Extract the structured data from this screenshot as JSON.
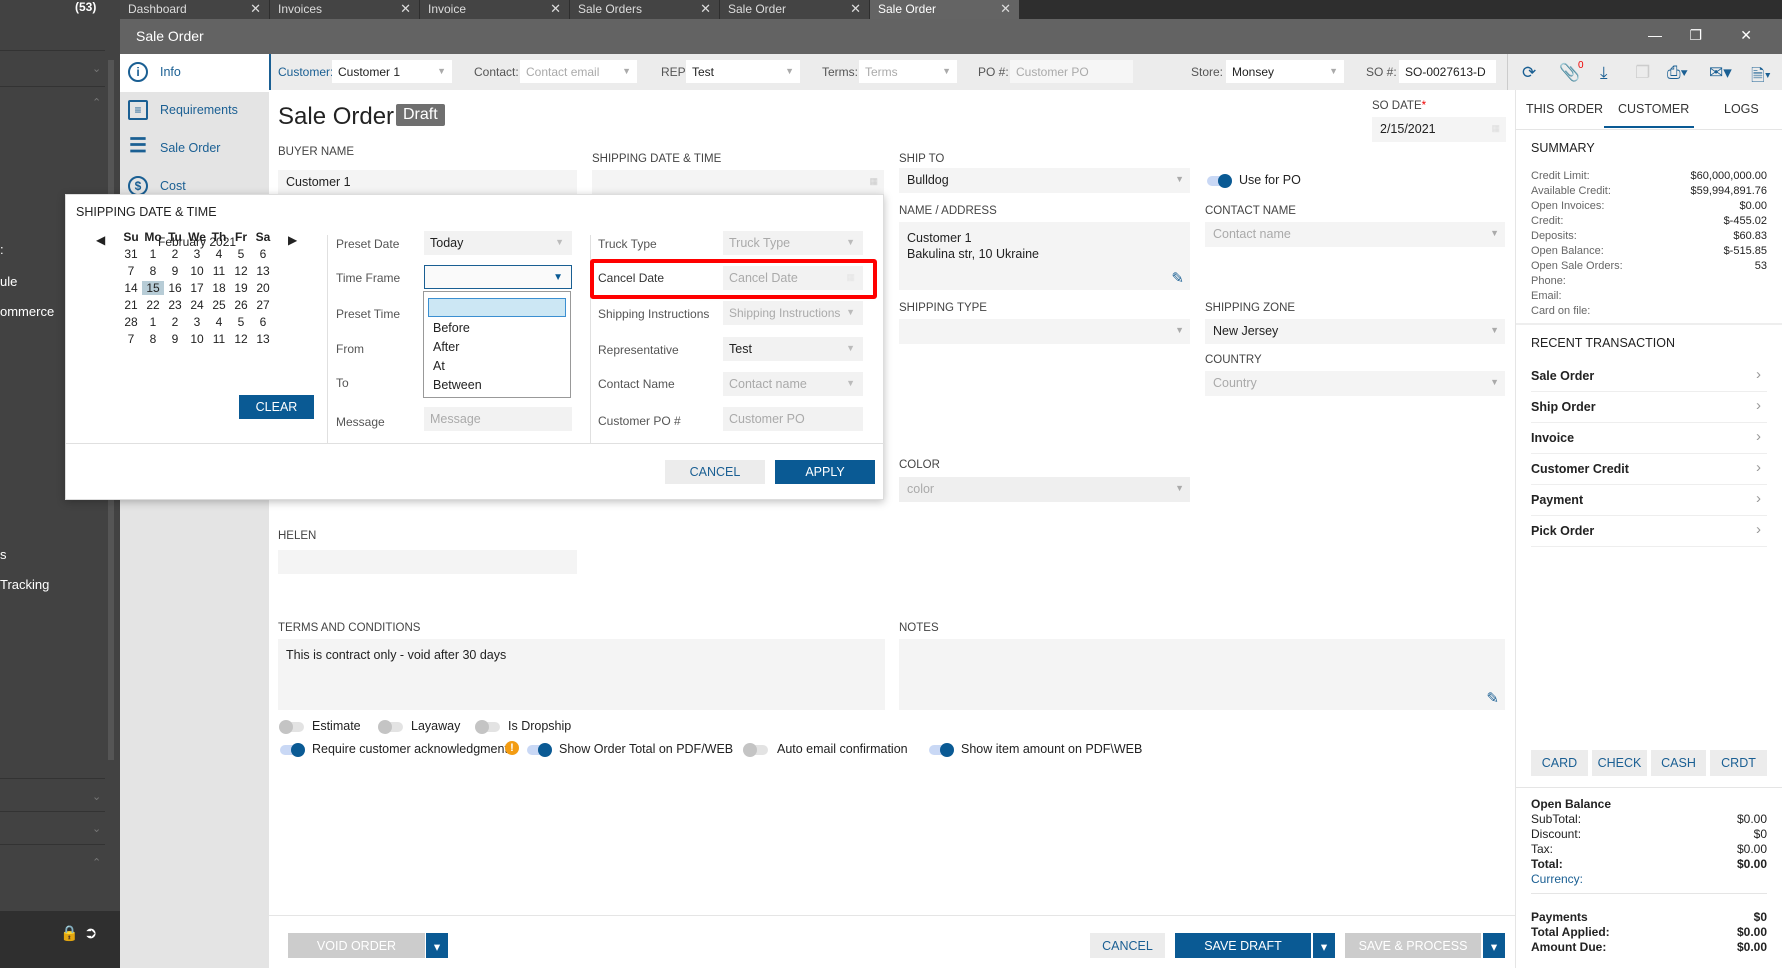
{
  "sidebar_dark": {
    "count": "(53)",
    "items": [
      ":",
      "ule",
      "ommerce",
      "s",
      "Tracking"
    ]
  },
  "tabs": [
    {
      "label": "Dashboard"
    },
    {
      "label": "Invoices"
    },
    {
      "label": "Invoice"
    },
    {
      "label": "Sale Orders"
    },
    {
      "label": "Sale Order"
    },
    {
      "label": "Sale Order",
      "active": true
    }
  ],
  "window": {
    "title": "Sale Order"
  },
  "nav": [
    {
      "label": "Info",
      "icon": "info-icon"
    },
    {
      "label": "Requirements",
      "icon": "clipboard-icon"
    },
    {
      "label": "Sale Order",
      "icon": "list-icon"
    },
    {
      "label": "Cost",
      "icon": "dollar-icon"
    }
  ],
  "toolbar": {
    "customer_label": "Customer:",
    "customer": "Customer 1",
    "contact_label": "Contact:",
    "contact_placeholder": "Contact email",
    "rep_label": "REP:",
    "rep": "Test",
    "terms_label": "Terms:",
    "terms_placeholder": "Terms",
    "po_label": "PO #:",
    "po_placeholder": "Customer PO",
    "store_label": "Store:",
    "store": "Monsey",
    "so_label": "SO #:",
    "so_number": "SO-0027613-D",
    "attachment_count": "0"
  },
  "form": {
    "title": "Sale Order",
    "status": "Draft",
    "so_date_label": "SO DATE",
    "so_date_required": "*",
    "so_date": "2/15/2021",
    "buyer_name_label": "BUYER NAME",
    "buyer_name": "Customer 1",
    "shipping_date_label": "SHIPPING DATE & TIME",
    "ship_to_label": "SHIP TO",
    "ship_to": "Bulldog",
    "use_for_po": "Use for PO",
    "name_address_label": "NAME / ADDRESS",
    "name_line": "Customer 1",
    "address_line": "Bakulina str, 10 Ukraine",
    "contact_name_label": "CONTACT NAME",
    "contact_name_placeholder": "Contact name",
    "shipping_type_label": "SHIPPING TYPE",
    "shipping_zone_label": "SHIPPING ZONE",
    "shipping_zone": "New Jersey",
    "country_label": "COUNTRY",
    "country_placeholder": "Country",
    "color_label": "COLOR",
    "color_placeholder": "color",
    "helen_label": "HELEN",
    "terms_label": "TERMS AND CONDITIONS",
    "terms_text": "This is contract only - void after 30 days",
    "notes_label": "NOTES",
    "toggles": [
      {
        "label": "Estimate",
        "on": false
      },
      {
        "label": "Layaway",
        "on": false
      },
      {
        "label": "Is Dropship",
        "on": false
      },
      {
        "label": "Require customer acknowledgment",
        "on": true
      },
      {
        "label": "Show Order Total on PDF/WEB",
        "on": true
      },
      {
        "label": "Auto email confirmation",
        "on": false
      },
      {
        "label": "Show item amount on PDF\\WEB",
        "on": true
      }
    ]
  },
  "bottom": {
    "void": "VOID ORDER",
    "cancel": "CANCEL",
    "save_draft": "SAVE DRAFT",
    "save_process": "SAVE & PROCESS"
  },
  "popup": {
    "title": "SHIPPING DATE & TIME",
    "month": "February 2021",
    "weekdays": [
      "Su",
      "Mo",
      "Tu",
      "We",
      "Th",
      "Fr",
      "Sa"
    ],
    "days": [
      [
        "31",
        "1",
        "2",
        "3",
        "4",
        "5",
        "6"
      ],
      [
        "7",
        "8",
        "9",
        "10",
        "11",
        "12",
        "13"
      ],
      [
        "14",
        "15",
        "16",
        "17",
        "18",
        "19",
        "20"
      ],
      [
        "21",
        "22",
        "23",
        "24",
        "25",
        "26",
        "27"
      ],
      [
        "28",
        "1",
        "2",
        "3",
        "4",
        "5",
        "6"
      ],
      [
        "7",
        "8",
        "9",
        "10",
        "11",
        "12",
        "13"
      ]
    ],
    "selected_day": "15",
    "clear": "CLEAR",
    "preset_date_label": "Preset Date",
    "preset_date": "Today",
    "time_frame_label": "Time Frame",
    "time_frame_options": [
      "",
      "Before",
      "After",
      "At",
      "Between"
    ],
    "preset_time_label": "Preset Time",
    "from_label": "From",
    "to_label": "To",
    "message_label": "Message",
    "message_placeholder": "Message",
    "truck_type_label": "Truck Type",
    "truck_type_placeholder": "Truck Type",
    "cancel_date_label": "Cancel Date",
    "cancel_date_placeholder": "Cancel Date",
    "shipping_instructions_label": "Shipping Instructions",
    "shipping_instructions_placeholder": "Shipping Instructions",
    "representative_label": "Representative",
    "representative": "Test",
    "contact_name_label": "Contact Name",
    "contact_name_placeholder": "Contact name",
    "customer_po_label": "Customer PO #",
    "customer_po_placeholder": "Customer PO",
    "cancel": "CANCEL",
    "apply": "APPLY"
  },
  "right": {
    "tabs": [
      "THIS ORDER",
      "CUSTOMER",
      "LOGS"
    ],
    "summary_title": "SUMMARY",
    "summary": [
      {
        "label": "Credit Limit:",
        "value": "$60,000,000.00"
      },
      {
        "label": "Available Credit:",
        "value": "$59,994,891.76"
      },
      {
        "label": "Open Invoices:",
        "value": "$0.00"
      },
      {
        "label": "Credit:",
        "value": "$-455.02"
      },
      {
        "label": "Deposits:",
        "value": "$60.83"
      },
      {
        "label": "Open Balance:",
        "value": "$-515.85"
      },
      {
        "label": "Open Sale Orders:",
        "value": "53"
      },
      {
        "label": "Phone:",
        "value": ""
      },
      {
        "label": "Email:",
        "value": ""
      },
      {
        "label": "Card on file:",
        "value": ""
      }
    ],
    "recent_title": "RECENT TRANSACTION",
    "recent": [
      "Sale Order",
      "Ship Order",
      "Invoice",
      "Customer Credit",
      "Payment",
      "Pick Order"
    ],
    "pay_buttons": [
      "CARD",
      "CHECK",
      "CASH",
      "CRDT"
    ],
    "open_balance_title": "Open Balance",
    "balance": [
      {
        "label": "SubTotal:",
        "value": "$0.00"
      },
      {
        "label": "Discount:",
        "value": "$0"
      },
      {
        "label": "Tax:",
        "value": "$0.00"
      },
      {
        "label": "Total:",
        "value": "$0.00",
        "bold": true
      }
    ],
    "currency_label": "Currency:",
    "payments": [
      {
        "label": "Payments",
        "value": "$0"
      },
      {
        "label": "Total Applied:",
        "value": "$0.00"
      },
      {
        "label": "Amount Due:",
        "value": "$0.00"
      }
    ]
  },
  "colors": {
    "accent": "#0a5a94",
    "highlight": "#ff0000",
    "warning": "#f39c12"
  }
}
